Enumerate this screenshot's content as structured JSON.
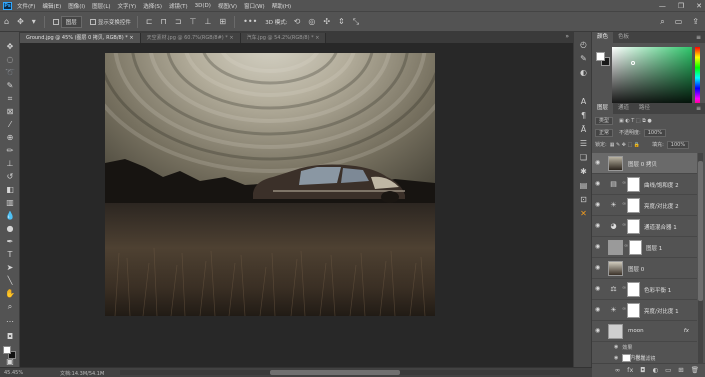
{
  "menu": [
    "文件(F)",
    "编辑(E)",
    "图像(I)",
    "图层(L)",
    "文字(Y)",
    "选择(S)",
    "滤镜(T)",
    "3D(D)",
    "视图(V)",
    "窗口(W)",
    "帮助(H)"
  ],
  "options_bar": {
    "auto_select_label": "图层",
    "transform_label": "显示变换控件",
    "mode_label": "3D 模式:"
  },
  "doc_tabs": [
    {
      "label": "Ground.jpg @ 45% (图层 0 拷贝, RGB/8) *",
      "close": "×"
    },
    {
      "label": "天空素材.jpg @ 60.7%(RGB/8#) *",
      "close": "×"
    },
    {
      "label": "汽车.jpg @ 54.2%(RGB/8) *",
      "close": "×"
    }
  ],
  "status": {
    "zoom": "45.45%",
    "doc": "文档:14.3M/54.1M"
  },
  "color_panel": {
    "tabs": [
      "颜色",
      "色板"
    ]
  },
  "layers_panel": {
    "tabs": [
      "图层",
      "通道",
      "路径"
    ],
    "filter_kind": "类型",
    "blend_mode": "正常",
    "opacity_label": "不透明度:",
    "opacity": "100%",
    "lock_label": "锁定:",
    "fill_label": "填充:",
    "fill": "100%",
    "layers": [
      {
        "name": "图层 0 拷贝"
      },
      {
        "name": "曲线/饱和度 2"
      },
      {
        "name": "亮度/对比度 2"
      },
      {
        "name": "通道混合器 1"
      },
      {
        "name": "图层 1"
      },
      {
        "name": "图层 0"
      },
      {
        "name": "色彩平衡 1"
      },
      {
        "name": "亮度/对比度 1"
      },
      {
        "name": "moon",
        "fx": "fx"
      },
      {
        "name": "效果"
      },
      {
        "name": "内发光"
      },
      {
        "name": "智能滤镜"
      }
    ]
  },
  "colors": {
    "ui_dark": "#535353",
    "panel_bg": "#424242",
    "canvas_bg": "#282828",
    "accent": "#31a8ff",
    "highlight": "#f29c1f"
  },
  "icons": [
    "home-icon",
    "move-icon",
    "eye-icon",
    "chain-icon",
    "hue-icon",
    "link-icon",
    "fx-icon",
    "new-layer-icon",
    "trash-icon",
    "cross-tools-icon"
  ]
}
